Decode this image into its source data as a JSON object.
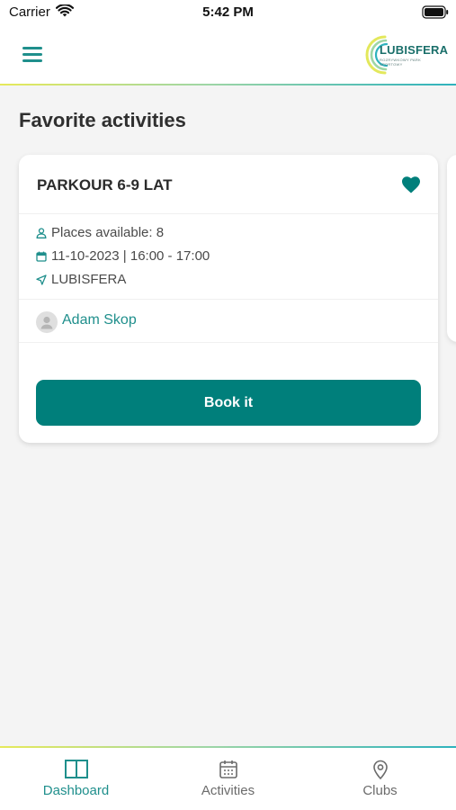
{
  "status_bar": {
    "carrier": "Carrier",
    "time": "5:42 PM"
  },
  "header": {
    "logo_text": "LUBISFERA",
    "logo_sub": "ROZRYWKOWY PARK SPORTOWY"
  },
  "page": {
    "title": "Favorite activities"
  },
  "activity": {
    "title": "PARKOUR 6-9 LAT",
    "places": "Places available: 8",
    "datetime": "11-10-2023 | 16:00 - 17:00",
    "location": "LUBISFERA",
    "trainer": "Adam Skop",
    "book_label": "Book it",
    "favorite": true
  },
  "tabs": [
    {
      "label": "Dashboard",
      "icon": "book-open-icon",
      "active": true
    },
    {
      "label": "Activities",
      "icon": "calendar-icon",
      "active": false
    },
    {
      "label": "Clubs",
      "icon": "map-pin-icon",
      "active": false
    }
  ],
  "colors": {
    "accent": "#007f7b",
    "accent_text": "#1f8f8c",
    "inactive": "#6b6b6b",
    "background": "#f4f4f4"
  }
}
